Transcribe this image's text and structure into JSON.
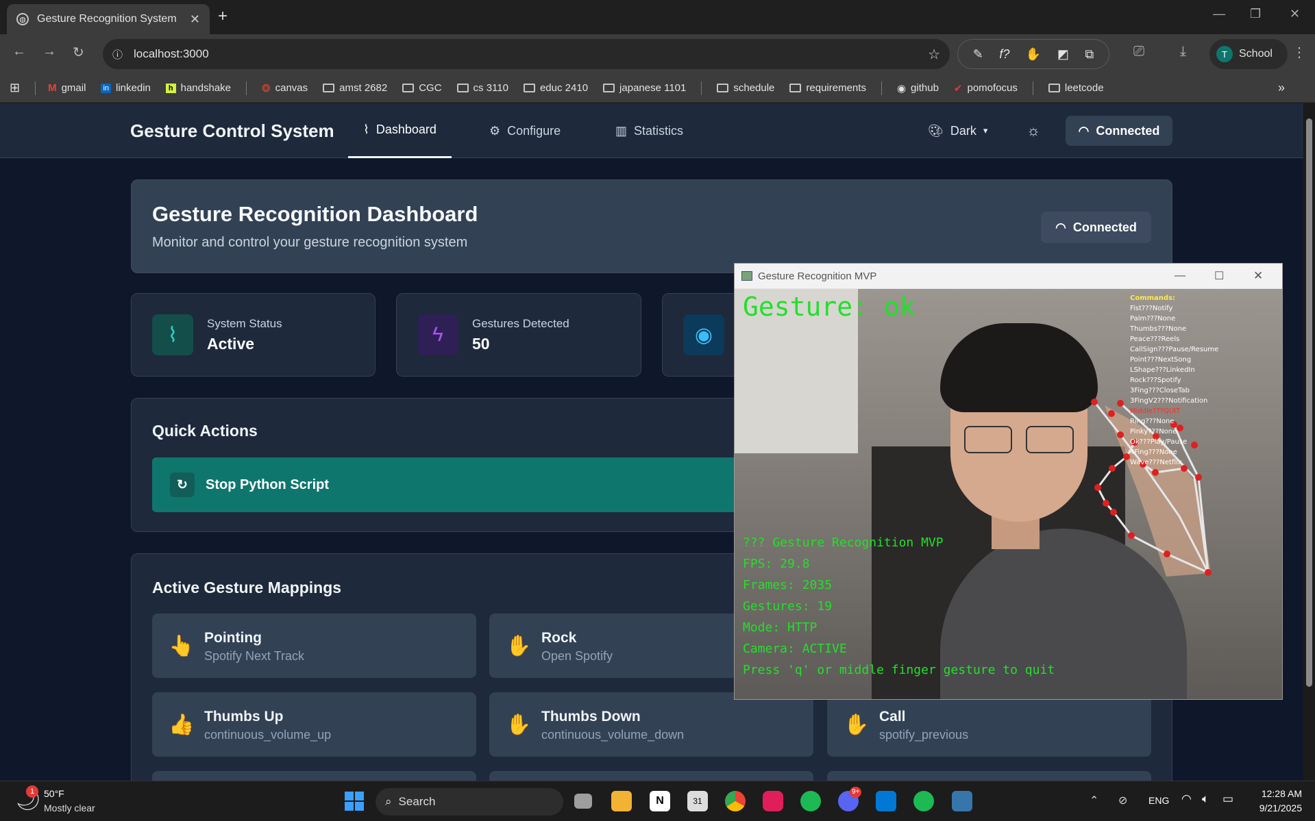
{
  "browser": {
    "tab_title": "Gesture Recognition System",
    "url": "localhost:3000",
    "profile_initial": "T",
    "profile_name": "School",
    "bookmarks": [
      "gmail",
      "linkedin",
      "handshake",
      "canvas",
      "amst 2682",
      "CGC",
      "cs 3110",
      "educ 2410",
      "japanese 1101",
      "schedule",
      "requirements",
      "github",
      "pomofocus",
      "leetcode"
    ]
  },
  "app": {
    "brand": "Gesture Control System",
    "nav": {
      "dashboard": "Dashboard",
      "configure": "Configure",
      "statistics": "Statistics"
    },
    "theme_label": "Dark",
    "connection_label": "Connected",
    "header_title": "Gesture Recognition Dashboard",
    "header_subtitle": "Monitor and control your gesture recognition system",
    "header_status": "Connected",
    "stats": [
      {
        "label": "System Status",
        "value": "Active"
      },
      {
        "label": "Gestures Detected",
        "value": "50"
      }
    ],
    "quick_actions_title": "Quick Actions",
    "stop_button": "Stop Python Script",
    "mappings_title": "Active Gesture Mappings",
    "mappings": [
      {
        "name": "Pointing",
        "action": "Spotify Next Track",
        "emoji": "👆"
      },
      {
        "name": "Rock",
        "action": "Open Spotify",
        "emoji": "✋"
      },
      {
        "name": "Thumbs Up",
        "action": "continuous_volume_up",
        "emoji": "👍"
      },
      {
        "name": "Thumbs Down",
        "action": "continuous_volume_down",
        "emoji": "✋"
      },
      {
        "name": "Call",
        "action": "spotify_previous",
        "emoji": "✋"
      }
    ],
    "colors": {
      "accent": "#0f766e",
      "bg": "#0f172a",
      "card": "#1e293b"
    }
  },
  "camera": {
    "window_title": "Gesture Recognition MVP",
    "gesture_line": "Gesture: ok",
    "commands_title": "Commands:",
    "commands": [
      "Fist???Notify",
      "Palm???None",
      "Thumbs???None",
      "Peace???Reels",
      "CallSign???Pause/Resume",
      "Point???NextSong",
      "LShape???LinkedIn",
      "Rock???Spotify",
      "3Fing???CloseTab",
      "3FingV2???Notification",
      "Middle???QUIT",
      "Ring???None",
      "Pinky???None",
      "Ok???Play/Pause",
      "4Fing???None",
      "Wave???Netflix"
    ],
    "overlay": [
      "??? Gesture Recognition MVP",
      "FPS: 29.8",
      "Frames: 2035",
      "Gestures: 19",
      "Mode: HTTP",
      "Camera: ACTIVE",
      "Press 'q' or middle finger gesture to quit"
    ]
  },
  "taskbar": {
    "weather_temp": "50°F",
    "weather_desc": "Mostly clear",
    "search": "Search",
    "lang": "ENG",
    "time": "12:28 AM",
    "date": "9/21/2025",
    "badge_weather": "1",
    "badge_discord": "9+"
  }
}
